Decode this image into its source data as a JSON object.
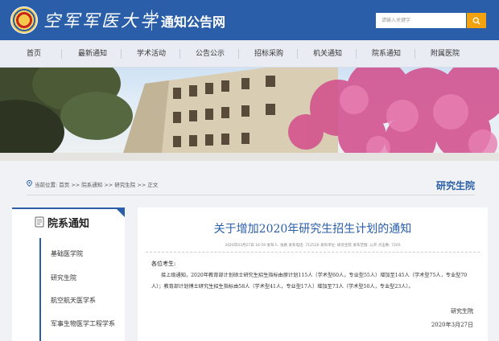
{
  "header": {
    "university_name": "空军军医大学",
    "site_title": "通知公告网",
    "search_placeholder": "请输入关键字",
    "search_icon": "search-icon",
    "colors": {
      "primary": "#2a5ea8",
      "search_button": "#f3a20f"
    }
  },
  "nav": {
    "items": [
      {
        "label": "首页"
      },
      {
        "label": "最新通知"
      },
      {
        "label": "学术活动"
      },
      {
        "label": "公告公示"
      },
      {
        "label": "招标采购"
      },
      {
        "label": "机关通知"
      },
      {
        "label": "院系通知"
      },
      {
        "label": "附属医院"
      }
    ]
  },
  "breadcrumb": {
    "text": "当前位置: 首页 >> 院系通知 >> 研究生院 >> 正文",
    "section_title": "研究生院"
  },
  "sidebar": {
    "heading": "院系通知",
    "items": [
      {
        "label": "基础医学院"
      },
      {
        "label": "研究生院"
      },
      {
        "label": "航空航天医学系"
      },
      {
        "label": "军事生物医学工程学系"
      }
    ]
  },
  "article": {
    "title": "关于增加2020年研究生招生计划的通知",
    "meta": "2020年03月27日 16:59    发布人: 张路    发布电话: 712526    发布单位: 研究生院    发布范围: 公开    点击数: 7205",
    "greeting": "各位考生:",
    "body": "接上级通知，2020年教育部计划硕士研究生招生指标由原计划115人（学术型60人，专业型55人）增加至145人（学术型75人，专业型70人）；教育部计划博士研究生招生指标由58人（学术型41人，专业型17人）增加至73人（学术型50人，专业型23人）。",
    "signature": "研究生院",
    "date": "2020年3月27日"
  }
}
